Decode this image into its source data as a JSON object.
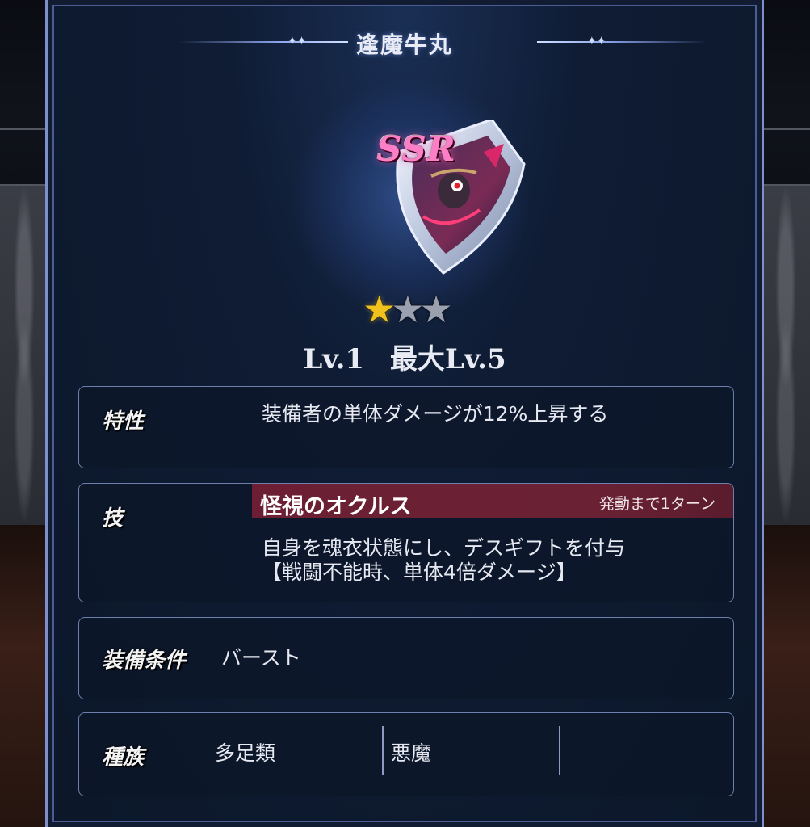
{
  "title": "逢魔牛丸",
  "item": {
    "rarity": "SSR",
    "stars_filled": 1,
    "stars_total": 3,
    "level": "Lv.1",
    "max_level": "最大Lv.5"
  },
  "trait": {
    "label": "特性",
    "text": "装備者の単体ダメージが12%上昇する"
  },
  "skill": {
    "label": "技",
    "name": "怪視のオクルス",
    "cooldown": "発動まで1ターン",
    "line1": "自身を魂衣状態にし、デスギフトを付与",
    "line2": "【戦闘不能時、単体4倍ダメージ】"
  },
  "equip_condition": {
    "label": "装備条件",
    "value": "バースト"
  },
  "race": {
    "label": "種族",
    "values": [
      "多足類",
      "悪魔",
      ""
    ]
  },
  "colors": {
    "skill_bar": "#6c1f34",
    "ssr": "#ff7ec8",
    "star_filled": "#f1c21e",
    "star_empty": "#9aa0ad",
    "panel_border": "#7f8fc9"
  },
  "icons": {
    "star_filled": "star-filled-icon",
    "star_empty": "star-empty-icon",
    "item_art": "shield-icon"
  }
}
